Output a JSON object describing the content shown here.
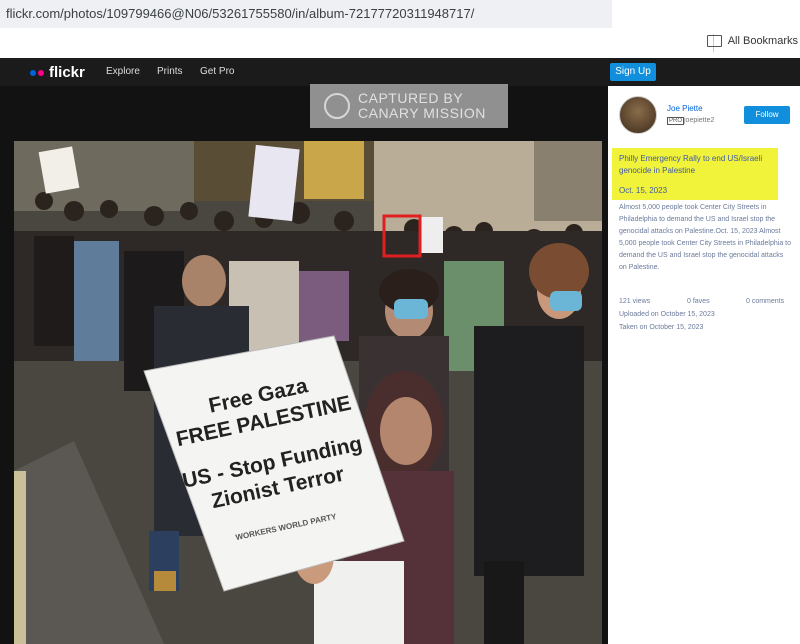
{
  "browser": {
    "url": "flickr.com/photos/109799466@N06/53261755580/in/album-72177720311948717/",
    "bookmarks_label": "All Bookmarks"
  },
  "nav": {
    "logo": "flickr",
    "links": [
      "Explore",
      "Prints",
      "Get Pro"
    ],
    "signup": "Sign Up"
  },
  "watermark": {
    "line1": "CAPTURED BY",
    "line2": "CANARY MISSION"
  },
  "sidebar": {
    "user_name": "Joe Piette",
    "pro_badge": "PRO",
    "user_handle": "joepiette2",
    "follow": "Follow",
    "title": "Philly Emergency Rally to end US/Israeli genocide in Palestine",
    "date": "Oct. 15, 2023",
    "description": "Almost 5,000 people took Center City Streets in Philadelphia to demand the US and Israel stop the genocidal attacks on Palestine.Oct. 15, 2023 Almost 5,000 people took Center City Streets in Philadelphia to demand the US and Israel stop the genocidal attacks on Palestine.",
    "views": "121 views",
    "faves": "0 faves",
    "comments": "0 comments",
    "uploaded": "Uploaded on October 15, 2023",
    "taken": "Taken on October 15, 2023"
  },
  "photo": {
    "sign_line1": "Free Gaza",
    "sign_line2": "FREE PALESTINE",
    "sign_line3": "US - Stop Funding",
    "sign_line4": "Zionist Terror",
    "sign_footer": "WORKERS WORLD PARTY"
  },
  "colors": {
    "flickr_blue": "#0063dc",
    "flickr_pink": "#ff0084",
    "button_blue": "#128fdc",
    "highlight_yellow": "#f1f23a",
    "marker_red": "#e02020"
  }
}
